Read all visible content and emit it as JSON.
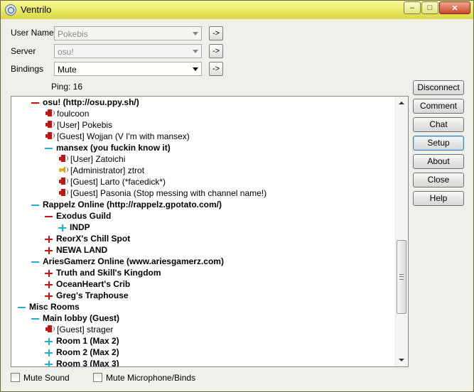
{
  "window": {
    "title": "Ventrilo",
    "controls": {
      "minimize": "–",
      "maximize": "□",
      "close": "✕"
    }
  },
  "form": {
    "user_name_label": "User Name",
    "user_name_value": "Pokebis",
    "server_label": "Server",
    "server_value": "osu!",
    "bindings_label": "Bindings",
    "bindings_value": "Mute",
    "arrow_button_label": "->",
    "ping_text": "Ping: 16"
  },
  "buttons": {
    "disconnect": "Disconnect",
    "comment": "Comment",
    "chat": "Chat",
    "setup": "Setup",
    "about": "About",
    "close": "Close",
    "help": "Help"
  },
  "tree": [
    {
      "text": "osu! (http://osu.ppy.sh/)",
      "icon": "minus",
      "color": "red",
      "bold": true
    },
    {
      "text": "foulcoon",
      "icon": "speaker",
      "color": "red"
    },
    {
      "text": "[User] Pokebis",
      "icon": "speaker",
      "color": "red"
    },
    {
      "text": "[Guest] Wojjan (V I'm with mansex)",
      "icon": "speaker",
      "color": "red"
    },
    {
      "text": "mansex (you fuckin know it)",
      "icon": "minus",
      "color": "cyan",
      "bold": true
    },
    {
      "text": "[User] Zatoichi",
      "icon": "speaker",
      "color": "red"
    },
    {
      "text": "[Administrator] ztrot",
      "icon": "speaker",
      "color": "yellow"
    },
    {
      "text": "[Guest] Larto (*facedick*)",
      "icon": "speaker",
      "color": "red"
    },
    {
      "text": "[Guest] Pasonia (Stop messing with channel name!)",
      "icon": "speaker",
      "color": "red"
    },
    {
      "text": "Rappelz Online (http://rappelz.gpotato.com/)",
      "icon": "minus",
      "color": "cyan",
      "bold": true
    },
    {
      "text": "Exodus Guild",
      "icon": "minus",
      "color": "red",
      "bold": true
    },
    {
      "text": "INDP",
      "icon": "plus",
      "color": "cyan",
      "bold": true
    },
    {
      "text": "ReorX's Chill Spot",
      "icon": "plus",
      "color": "red",
      "bold": true
    },
    {
      "text": "NEWA LAND",
      "icon": "plus",
      "color": "red",
      "bold": true
    },
    {
      "text": "AriesGamerz Online (www.ariesgamerz.com)",
      "icon": "minus",
      "color": "cyan",
      "bold": true
    },
    {
      "text": "Truth and Skill's Kingdom",
      "icon": "plus",
      "color": "red",
      "bold": true
    },
    {
      "text": "OceanHeart's Crib",
      "icon": "plus",
      "color": "red",
      "bold": true
    },
    {
      "text": "Greg's Traphouse",
      "icon": "plus",
      "color": "red",
      "bold": true
    },
    {
      "text": "Misc Rooms",
      "icon": "minus",
      "color": "cyan",
      "bold": true
    },
    {
      "text": "Main lobby (Guest)",
      "icon": "minus",
      "color": "cyan",
      "bold": true
    },
    {
      "text": "[Guest] strager",
      "icon": "speaker",
      "color": "red"
    },
    {
      "text": "Room 1 (Max 2)",
      "icon": "plus",
      "color": "cyan",
      "bold": true
    },
    {
      "text": "Room 2 (Max 2)",
      "icon": "plus",
      "color": "cyan",
      "bold": true
    },
    {
      "text": "Room 3 (Max 3)",
      "icon": "plus",
      "color": "cyan",
      "bold": true
    }
  ],
  "checkboxes": {
    "mute_sound": "Mute Sound",
    "mute_mic": "Mute Microphone/Binds"
  }
}
